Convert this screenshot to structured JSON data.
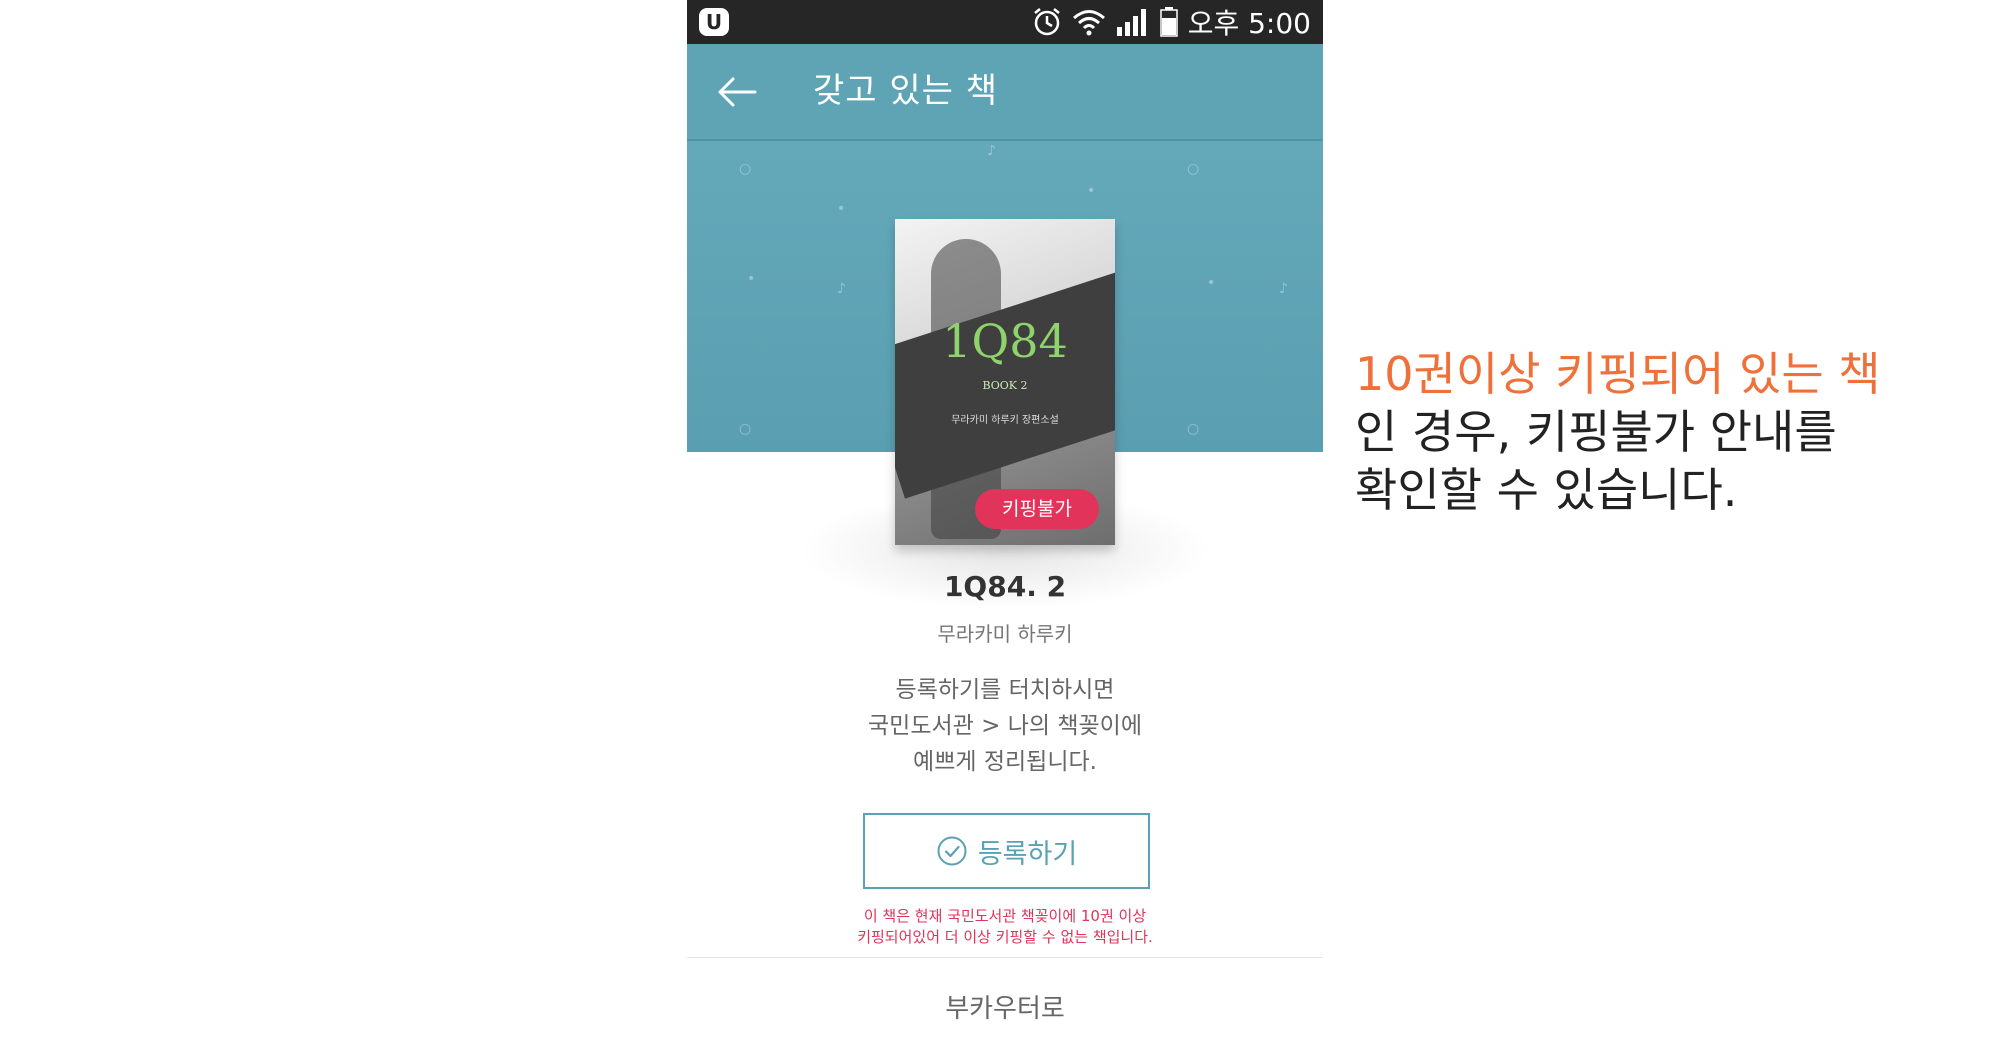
{
  "status_bar": {
    "time": "오후 5:00"
  },
  "app_bar": {
    "title": "갖고 있는 책"
  },
  "book": {
    "cover_title": "1Q84",
    "cover_subtitle": "BOOK 2",
    "cover_author": "무라카미 하루키 장편소설",
    "badge": "키핑불가",
    "title": "1Q84. 2",
    "author": "무라카미 하루키"
  },
  "description": {
    "lines": [
      "등록하기를 터치하시면",
      "국민도서관 > 나의 책꽂이에",
      "예쁘게 정리됩니다."
    ]
  },
  "register_button": {
    "label": "등록하기"
  },
  "warning": {
    "line1": "이 책은 현재 국민도서관 책꽂이에 10권 이상",
    "line2": "키핑되어있어 더 이상 키핑할 수 없는 책입니다."
  },
  "footer": {
    "label": "부카우터로"
  },
  "annotation": {
    "highlight": "10권이상 키핑되어 있는 책",
    "line2": "인 경우, 키핑불가 안내를",
    "line3": "확인할 수 있습니다."
  },
  "colors": {
    "accent": "#5ea4b5",
    "badge": "#e2335a",
    "annotation_highlight": "#f0703a"
  }
}
